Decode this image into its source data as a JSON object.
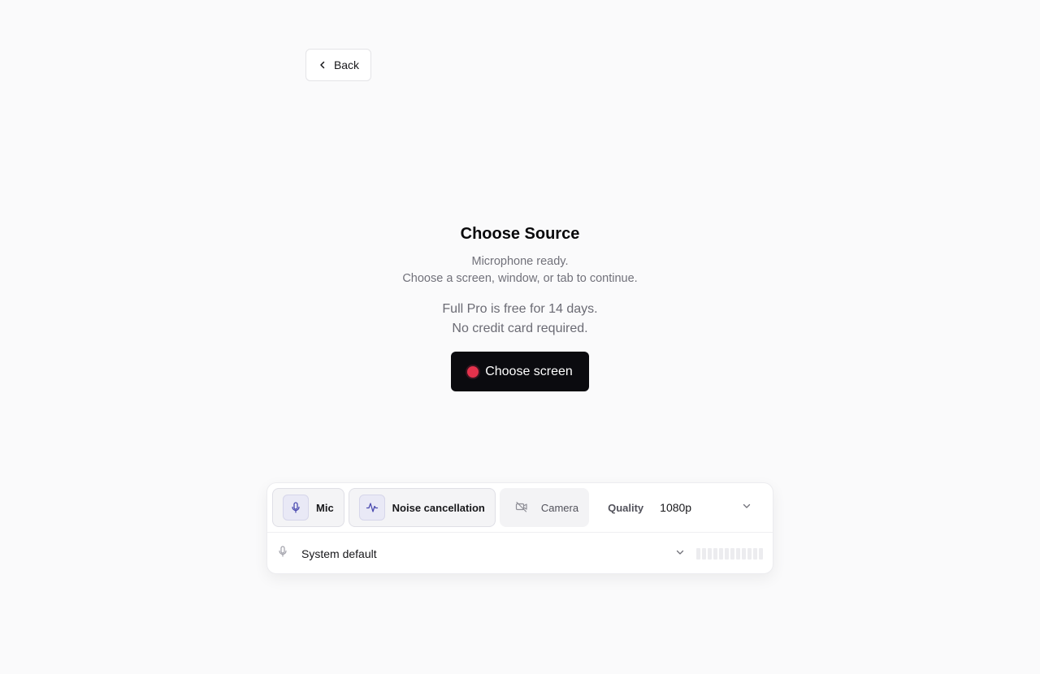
{
  "nav": {
    "back_label": "Back"
  },
  "main": {
    "title": "Choose Source",
    "subtitle_line1": "Microphone ready.",
    "subtitle_line2": "Choose a screen, window, or tab to continue.",
    "promo_line1": "Full Pro is free for 14 days.",
    "promo_line2": "No credit card required.",
    "cta_label": "Choose screen"
  },
  "controls": {
    "mic_label": "Mic",
    "noise_label": "Noise cancellation",
    "camera_label": "Camera",
    "quality_label": "Quality",
    "quality_value": "1080p",
    "device_value": "System default",
    "level_meter": 0
  },
  "colors": {
    "accent_record": "#e5324c",
    "primary_button": "#0b0b0f",
    "icon_accent": "#4b4bb0"
  }
}
